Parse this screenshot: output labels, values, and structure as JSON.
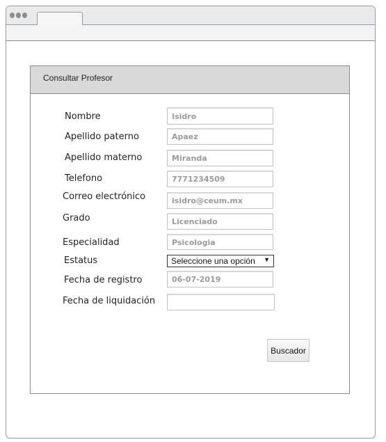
{
  "panel": {
    "title": "Consultar Profesor"
  },
  "fields": [
    {
      "label": "Nombre",
      "value": "Isidro"
    },
    {
      "label": "Apellido paterno",
      "value": "Apaez"
    },
    {
      "label": "Apellido materno",
      "value": "Miranda"
    },
    {
      "label": "Telefono",
      "value": "7771234509"
    },
    {
      "label": "Correo electrónico",
      "value": "isidro@ceum.mx"
    },
    {
      "label": "Grado",
      "value": "Licenciado"
    },
    {
      "label": "Especialidad",
      "value": "Psicologia"
    },
    {
      "label": "Estatus",
      "value": "Seleccione una opción"
    },
    {
      "label": "Fecha de registro",
      "value": "06-07-2019"
    },
    {
      "label": "Fecha de liquidación",
      "value": ""
    }
  ],
  "buttons": {
    "search": "Buscador"
  }
}
